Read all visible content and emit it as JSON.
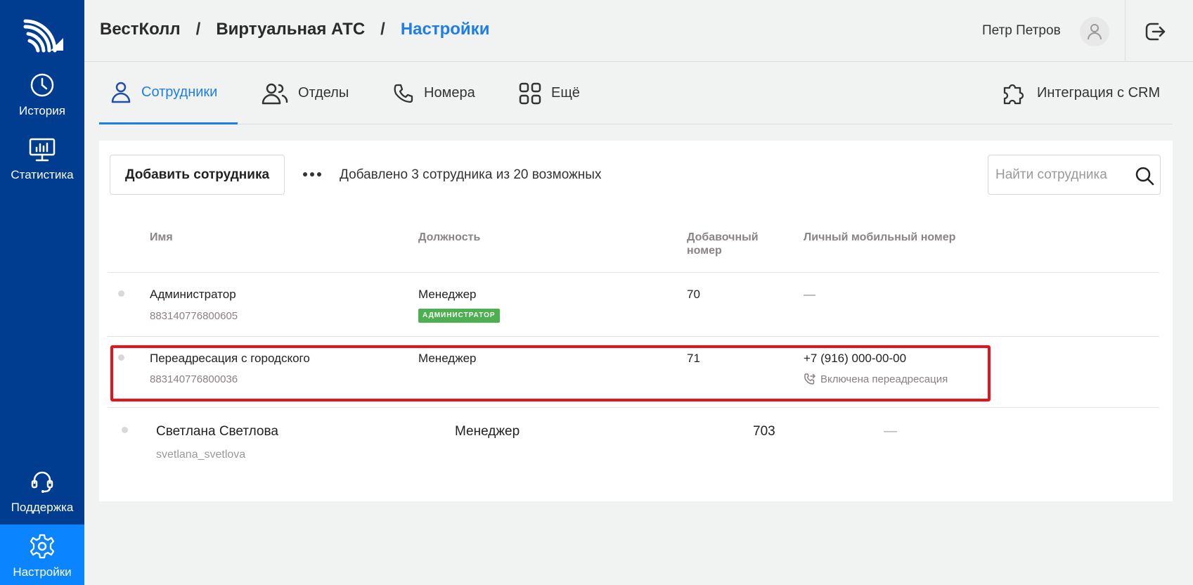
{
  "sidebar": {
    "items": [
      {
        "label": "История",
        "icon": "clock-icon"
      },
      {
        "label": "Статистика",
        "icon": "monitor-chart-icon"
      },
      {
        "label": "Поддержка",
        "icon": "headset-icon"
      },
      {
        "label": "Настройки",
        "icon": "gear-icon",
        "active": true
      }
    ],
    "bg_color": "#003d91",
    "active_color": "#0a84ff"
  },
  "header": {
    "breadcrumb": [
      "ВестКолл",
      "Виртуальная АТС",
      "Настройки"
    ],
    "separator": "/",
    "user_name": "Петр Петров"
  },
  "tabs": [
    {
      "label": "Сотрудники",
      "icon": "person-icon",
      "active": true
    },
    {
      "label": "Отделы",
      "icon": "people-icon"
    },
    {
      "label": "Номера",
      "icon": "phone-icon"
    },
    {
      "label": "Ещё",
      "icon": "grid-icon"
    },
    {
      "label": "Интеграция с CRM",
      "icon": "puzzle-icon"
    }
  ],
  "toolbar": {
    "add_label": "Добавить сотрудника",
    "count_text": "Добавлено 3 сотрудника из 20 возможных",
    "search_placeholder": "Найти сотрудника"
  },
  "table": {
    "columns": {
      "name": "Имя",
      "position": "Должность",
      "ext_line1": "Добавочный",
      "ext_line2": "номер",
      "mobile": "Личный мобильный номер"
    },
    "rows": [
      {
        "name": "Администратор",
        "login": "883140776800605",
        "position": "Менеджер",
        "badge": "АДМИНИСТРАТОР",
        "ext": "70",
        "mobile": "—"
      },
      {
        "name": "Переадресация с городского",
        "login": "883140776800036",
        "position": "Менеджер",
        "ext": "71",
        "mobile": "+7 (916) 000-00-00",
        "forward_note": "Включена переадресация"
      },
      {
        "name": "Светлана Светлова",
        "login": "svetlana_svetlova",
        "position": "Менеджер",
        "ext": "703",
        "mobile": "—"
      }
    ]
  },
  "colors": {
    "accent": "#1f7ee6",
    "badge": "#4caf50",
    "highlight": "#e8121d"
  }
}
